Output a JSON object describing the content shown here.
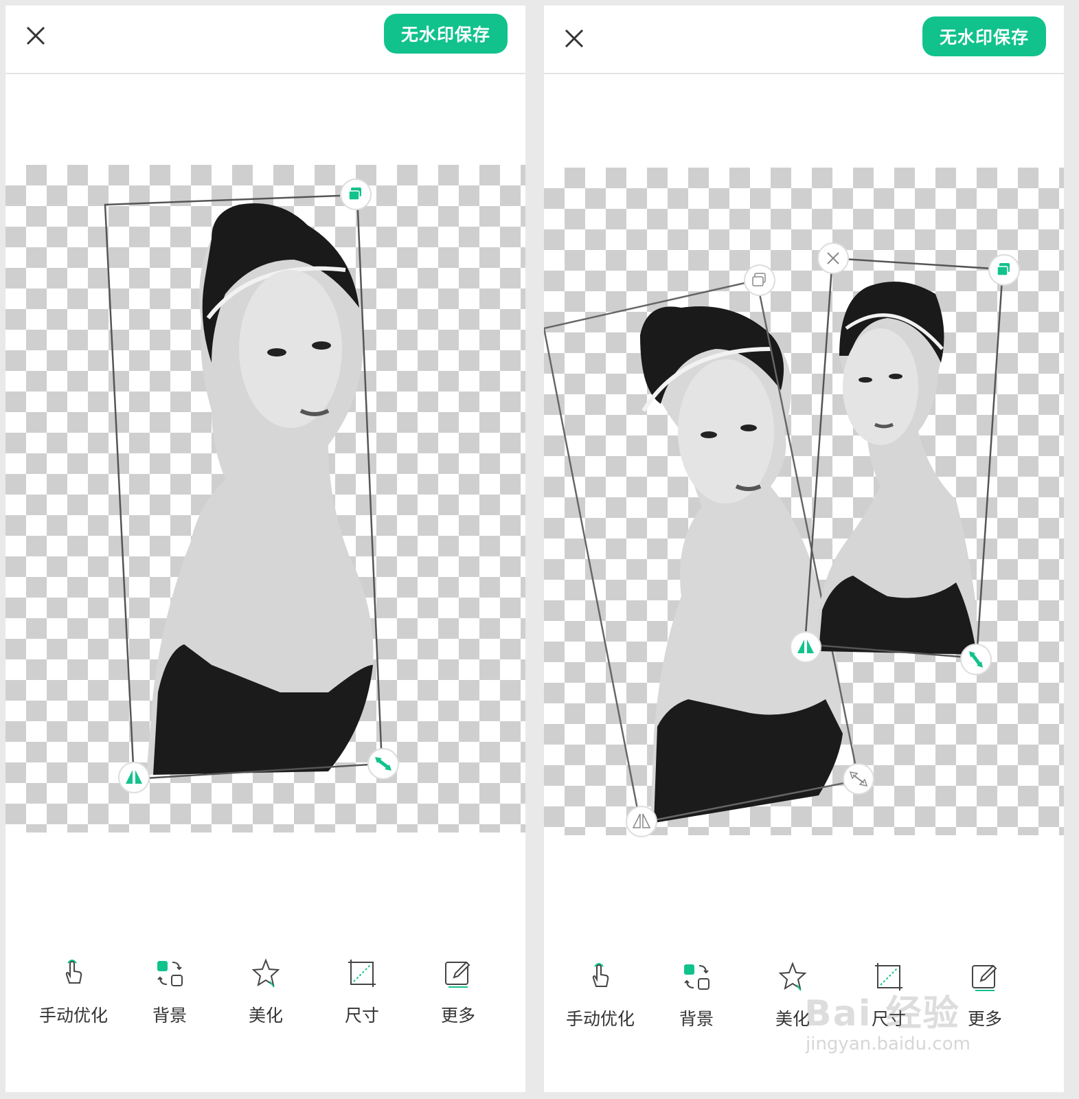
{
  "left_screen": {
    "save_label": "无水印保存",
    "tools": [
      {
        "label": "手动优化",
        "icon": "hand-tap-icon"
      },
      {
        "label": "背景",
        "icon": "background-swap-icon"
      },
      {
        "label": "美化",
        "icon": "star-beautify-icon"
      },
      {
        "label": "尺寸",
        "icon": "crop-size-icon"
      },
      {
        "label": "更多",
        "icon": "edit-more-icon"
      }
    ]
  },
  "right_screen": {
    "save_label": "无水印保存",
    "tools": [
      {
        "label": "手动优化",
        "icon": "hand-tap-icon"
      },
      {
        "label": "背景",
        "icon": "background-swap-icon"
      },
      {
        "label": "美化",
        "icon": "star-beautify-icon"
      },
      {
        "label": "尺寸",
        "icon": "crop-size-icon"
      },
      {
        "label": "更多",
        "icon": "edit-more-icon"
      }
    ]
  },
  "watermark": {
    "main": "Bai 经验",
    "sub": "jingyan.baidu.com"
  },
  "colors": {
    "accent": "#12c28c",
    "checker": "#cfcfcf",
    "frame": "#555555"
  }
}
